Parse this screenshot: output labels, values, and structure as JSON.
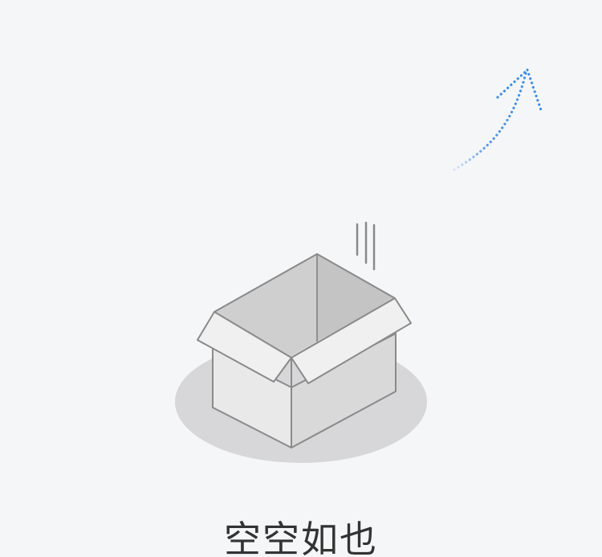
{
  "empty_state": {
    "message": "空空如也",
    "illustration_icon": "empty-box-icon",
    "hint_icon": "dotted-arrow-up-right-icon"
  },
  "colors": {
    "background": "#f5f6f8",
    "arrow_accent": "#3d8ee8",
    "text": "#333333"
  }
}
